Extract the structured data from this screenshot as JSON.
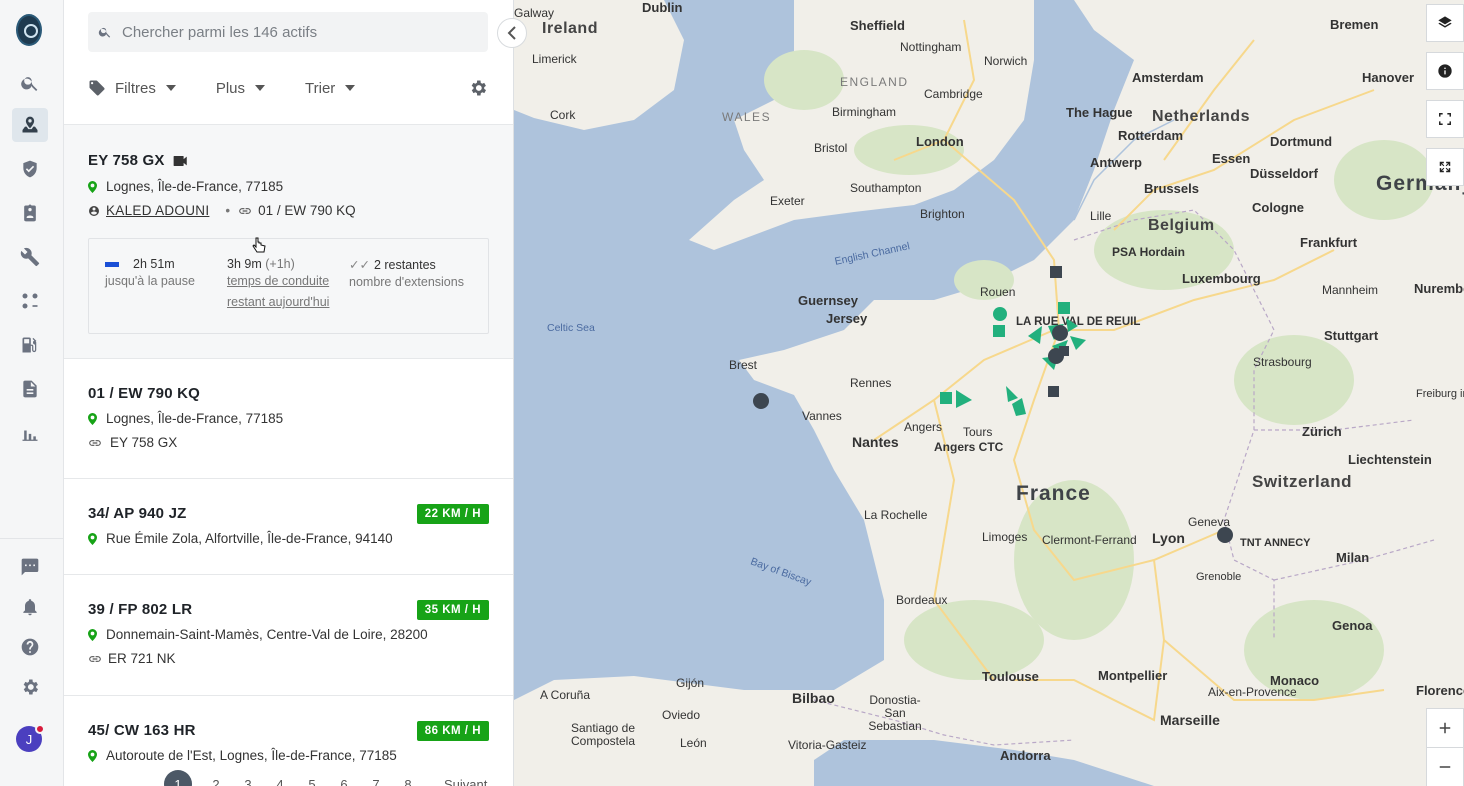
{
  "search": {
    "placeholder": "Chercher parmi les 146 actifs"
  },
  "toolbar": {
    "filters_label": "Filtres",
    "more_label": "Plus",
    "sort_label": "Trier"
  },
  "assets": [
    {
      "name": "EY 758 GX",
      "location": "Lognes, Île-de-France, 77185",
      "driver": "KALED ADOUNI",
      "linked": "01 / EW 790 KQ",
      "hos": {
        "break_value": "2h 51m",
        "break_label": "jusqu'à la pause",
        "drive_value": "3h 9m",
        "drive_extra": "(+1h)",
        "drive_label_1": "temps de conduite",
        "drive_label_2": "restant aujourd'hui",
        "ext_value": "2 restantes",
        "ext_label": "nombre d'extensions"
      }
    },
    {
      "name": "01 / EW 790 KQ",
      "location": "Lognes, Île-de-France, 77185",
      "linked": "EY 758 GX"
    },
    {
      "name": "34/ AP 940 JZ",
      "location": "Rue Émile Zola, Alfortville, Île-de-France, 94140",
      "speed": "22 KM / H"
    },
    {
      "name": "39 / FP 802 LR",
      "location": "Donnemain-Saint-Mamès, Centre-Val de Loire, 28200",
      "linked": "ER 721 NK",
      "speed": "35 KM / H"
    },
    {
      "name": "45/ CW 163 HR",
      "location": "Autoroute de l'Est, Lognes, Île-de-France, 77185",
      "speed": "86 KM / H"
    }
  ],
  "pagination": {
    "pages": [
      "1",
      "2",
      "3",
      "4",
      "5",
      "6",
      "7",
      "8"
    ],
    "next_label": "Suivant",
    "current": "1"
  },
  "user": {
    "initial": "J"
  },
  "colors": {
    "accent": "#17a317",
    "marker_green": "#22b07d",
    "marker_dark": "#3d4650",
    "water": "#aec3dc",
    "land": "#f1efe9"
  },
  "map": {
    "cities": [
      "Galway",
      "Dublin",
      "Ireland",
      "Limerick",
      "Cork",
      "Sheffield",
      "Nottingham",
      "Norwich",
      "ENGLAND",
      "WALES",
      "Cambridge",
      "Birmingham",
      "Bristol",
      "London",
      "Southampton",
      "Exeter",
      "Brighton",
      "Bremen",
      "Amsterdam",
      "Hanover",
      "The Hague",
      "Netherlands",
      "Rotterdam",
      "Dortmund",
      "Essen",
      "Düsseldorf",
      "Germany",
      "Antwerp",
      "Brussels",
      "Cologne",
      "Lille",
      "Belgium",
      "PSA Hordain",
      "Frankfurt",
      "Luxembourg",
      "Mannheim",
      "Nuremberg",
      "Guernsey",
      "Jersey",
      "Rouen",
      "LA RUE VAL DE REUIL",
      "Stuttgart",
      "Celtic Sea",
      "Brest",
      "Rennes",
      "Strasbourg",
      "Freiburg im Breisgau",
      "Vannes",
      "Angers",
      "Tours",
      "Nantes",
      "Angers CTC",
      "Zürich",
      "Liechtenstein",
      "France",
      "Switzerland",
      "La Rochelle",
      "Limoges",
      "Clermont-Ferrand",
      "Geneva",
      "Lyon",
      "TNT ANNECY",
      "Milan",
      "Bay of Biscay",
      "Grenoble",
      "Bordeaux",
      "Genoa",
      "Toulouse",
      "Montpellier",
      "Monaco",
      "Aix-en-Provence",
      "Florence",
      "A Coruña",
      "Gijón",
      "Oviedo",
      "Bilbao",
      "Donostia-San Sebastian",
      "Santiago de Compostela",
      "León",
      "Vitoria-Gasteiz",
      "Marseille",
      "Andorra",
      "English Channel"
    ]
  },
  "icons": [
    "search-icon",
    "tag-icon",
    "gear-icon",
    "video-icon",
    "pin-icon",
    "link-icon",
    "driver-icon",
    "layers-icon",
    "info-icon",
    "fullscreen-icon",
    "zoom-in-icon",
    "zoom-out-icon"
  ]
}
